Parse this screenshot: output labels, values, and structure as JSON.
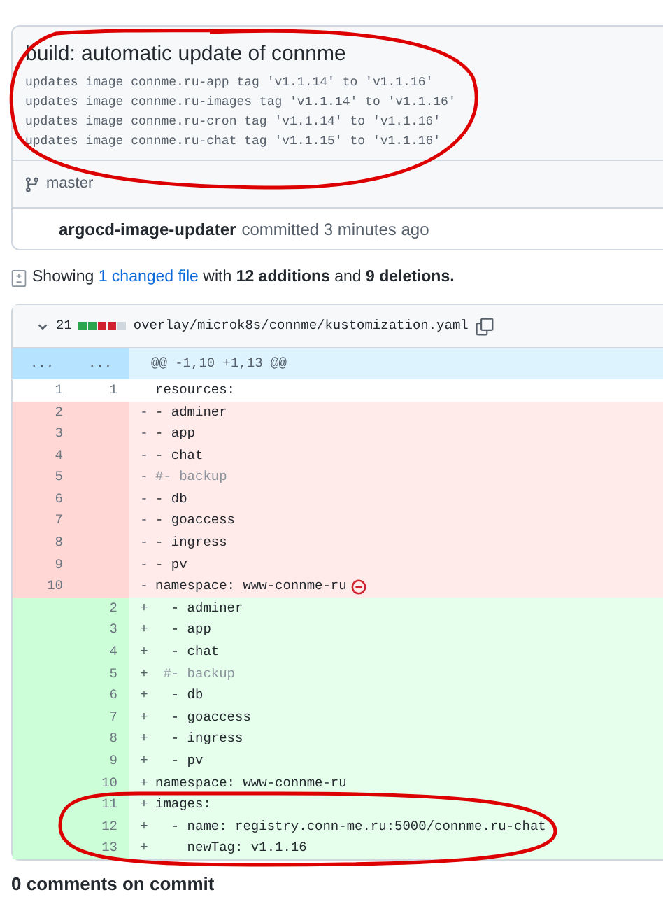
{
  "commit": {
    "title": "build: automatic update of connme",
    "message_lines": [
      "updates image connme.ru-app tag 'v1.1.14' to 'v1.1.16'",
      "updates image connme.ru-images tag 'v1.1.14' to 'v1.1.16'",
      "updates image connme.ru-cron tag 'v1.1.14' to 'v1.1.16'",
      "updates image connme.ru-chat tag 'v1.1.15' to 'v1.1.16'"
    ],
    "branch": "master",
    "author": "argocd-image-updater",
    "action": "committed 3 minutes ago"
  },
  "summary": {
    "prefix": "Showing",
    "files_link": "1 changed file",
    "middle": "with",
    "additions": "12 additions",
    "and": "and",
    "deletions": "9 deletions."
  },
  "file": {
    "expanded": true,
    "changes": "21",
    "diffstat": [
      {
        "kind": "added"
      },
      {
        "kind": "added"
      },
      {
        "kind": "deleted"
      },
      {
        "kind": "deleted"
      },
      {
        "kind": "neutral"
      }
    ],
    "path": "overlay/microk8s/connme/kustomization.yaml",
    "hunk": {
      "old": "...",
      "new": "...",
      "header": "@@ -1,10 +1,13 @@"
    },
    "rows": [
      {
        "kind": "context",
        "old": "1",
        "new": "1",
        "sign": "",
        "code": "resources:",
        "comment": false,
        "flagged": false
      },
      {
        "kind": "deleted",
        "old": "2",
        "sign": "-",
        "code": "- adminer",
        "comment": false,
        "flagged": false
      },
      {
        "kind": "deleted",
        "old": "3",
        "sign": "-",
        "code": "- app",
        "comment": false,
        "flagged": false
      },
      {
        "kind": "deleted",
        "old": "4",
        "sign": "-",
        "code": "- chat",
        "comment": false,
        "flagged": false
      },
      {
        "kind": "deleted",
        "old": "5",
        "sign": "-",
        "code": "#- backup",
        "comment": true,
        "flagged": false
      },
      {
        "kind": "deleted",
        "old": "6",
        "sign": "-",
        "code": "- db",
        "comment": false,
        "flagged": false
      },
      {
        "kind": "deleted",
        "old": "7",
        "sign": "-",
        "code": "- goaccess",
        "comment": false,
        "flagged": false
      },
      {
        "kind": "deleted",
        "old": "8",
        "sign": "-",
        "code": "- ingress",
        "comment": false,
        "flagged": false
      },
      {
        "kind": "deleted",
        "old": "9",
        "sign": "-",
        "code": "- pv",
        "comment": false,
        "flagged": false
      },
      {
        "kind": "deleted",
        "old": "10",
        "sign": "-",
        "code": "namespace: www-connme-ru",
        "comment": false,
        "flagged": true
      },
      {
        "kind": "added",
        "new": "2",
        "sign": "+",
        "code": "  - adminer",
        "comment": false,
        "flagged": false
      },
      {
        "kind": "added",
        "new": "3",
        "sign": "+",
        "code": "  - app",
        "comment": false,
        "flagged": false
      },
      {
        "kind": "added",
        "new": "4",
        "sign": "+",
        "code": "  - chat",
        "comment": false,
        "flagged": false
      },
      {
        "kind": "added",
        "new": "5",
        "sign": "+",
        "code": " #- backup",
        "comment": true,
        "flagged": false
      },
      {
        "kind": "added",
        "new": "6",
        "sign": "+",
        "code": "  - db",
        "comment": false,
        "flagged": false
      },
      {
        "kind": "added",
        "new": "7",
        "sign": "+",
        "code": "  - goaccess",
        "comment": false,
        "flagged": false
      },
      {
        "kind": "added",
        "new": "8",
        "sign": "+",
        "code": "  - ingress",
        "comment": false,
        "flagged": false
      },
      {
        "kind": "added",
        "new": "9",
        "sign": "+",
        "code": "  - pv",
        "comment": false,
        "flagged": false
      },
      {
        "kind": "added",
        "new": "10",
        "sign": "+",
        "code": "namespace: www-connme-ru",
        "comment": false,
        "flagged": false
      },
      {
        "kind": "added",
        "new": "11",
        "sign": "+",
        "code": "images:",
        "comment": false,
        "flagged": false
      },
      {
        "kind": "added",
        "new": "12",
        "sign": "+",
        "code": "  - name: registry.conn-me.ru:5000/connme.ru-chat",
        "comment": false,
        "flagged": false
      },
      {
        "kind": "added",
        "new": "13",
        "sign": "+",
        "code": "    newTag: v1.1.16",
        "comment": false,
        "flagged": false
      }
    ]
  },
  "comments_heading": "0 comments on commit"
}
